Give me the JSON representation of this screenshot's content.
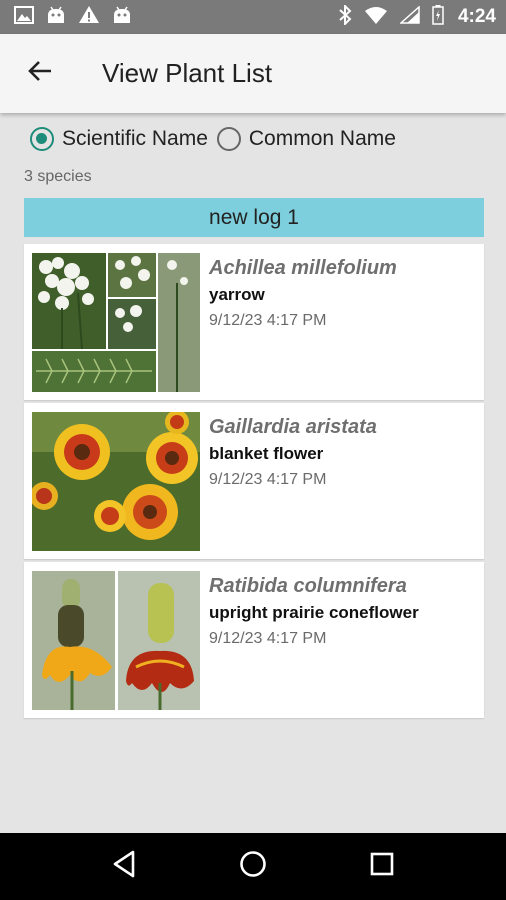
{
  "status_bar": {
    "time": "4:24",
    "left_icons": [
      "image-icon",
      "android-icon",
      "warning-icon",
      "android-icon"
    ],
    "right_icons": [
      "bluetooth-icon",
      "wifi-icon",
      "signal-icon",
      "battery-icon"
    ]
  },
  "app_bar": {
    "title": "View Plant List",
    "back_icon": "arrow-back-icon"
  },
  "name_toggle": {
    "selected": "scientific",
    "options": [
      {
        "id": "scientific",
        "label": "Scientific Name",
        "checked": true
      },
      {
        "id": "common",
        "label": "Common Name",
        "checked": false
      }
    ]
  },
  "species_count": "3 species",
  "log": {
    "title": "new log 1",
    "color": "#7ecfdd",
    "plants": [
      {
        "scientific": "Achillea millefolium",
        "common": "yarrow",
        "date": "9/12/23 4:17 PM"
      },
      {
        "scientific": "Gaillardia aristata",
        "common": "blanket flower",
        "date": "9/12/23 4:17 PM"
      },
      {
        "scientific": "Ratibida columnifera",
        "common": "upright prairie coneflower",
        "date": "9/12/23 4:17 PM"
      }
    ]
  },
  "nav_bar": {
    "buttons": [
      "back-triangle-icon",
      "home-circle-icon",
      "recents-square-icon"
    ]
  },
  "colors": {
    "accent": "#1e8c7a",
    "status_bar": "#7a7a7a",
    "background": "#e4e4e4"
  }
}
